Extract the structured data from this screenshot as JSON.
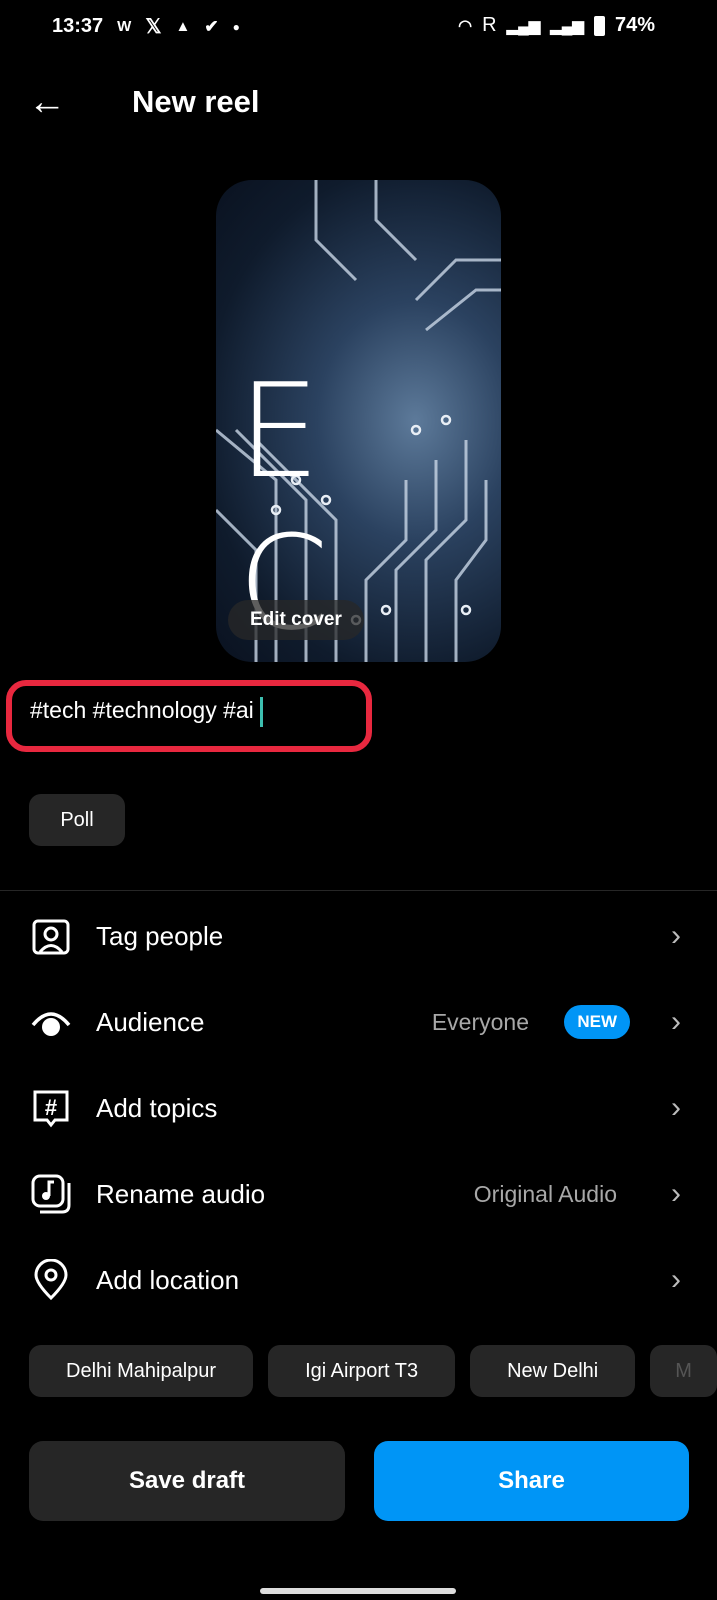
{
  "status_bar": {
    "time": "13:37",
    "left_icons": [
      "wikipedia-icon",
      "x-icon",
      "warning-icon",
      "download-done-icon",
      "dot-icon"
    ],
    "roaming": "R",
    "battery": "74%"
  },
  "header": {
    "title": "New reel"
  },
  "cover": {
    "letters": "E C",
    "edit_label": "Edit cover"
  },
  "caption": {
    "value": "#tech #technology #ai",
    "highlight_color": "#e8283f"
  },
  "poll_label": "Poll",
  "options": [
    {
      "label": "Tag people",
      "icon": "tag-people-icon"
    },
    {
      "label": "Audience",
      "value": "Everyone",
      "badge": "NEW",
      "icon": "audience-icon"
    },
    {
      "label": "Add topics",
      "icon": "hashtag-icon"
    },
    {
      "label": "Rename audio",
      "value": "Original Audio",
      "icon": "audio-icon"
    },
    {
      "label": "Add location",
      "icon": "location-icon"
    }
  ],
  "location_suggestions": [
    "Delhi Mahipalpur",
    "Igi Airport T3",
    "New Delhi",
    "M"
  ],
  "actions": {
    "save_draft": "Save draft",
    "share": "Share",
    "accent": "#0095f6"
  }
}
